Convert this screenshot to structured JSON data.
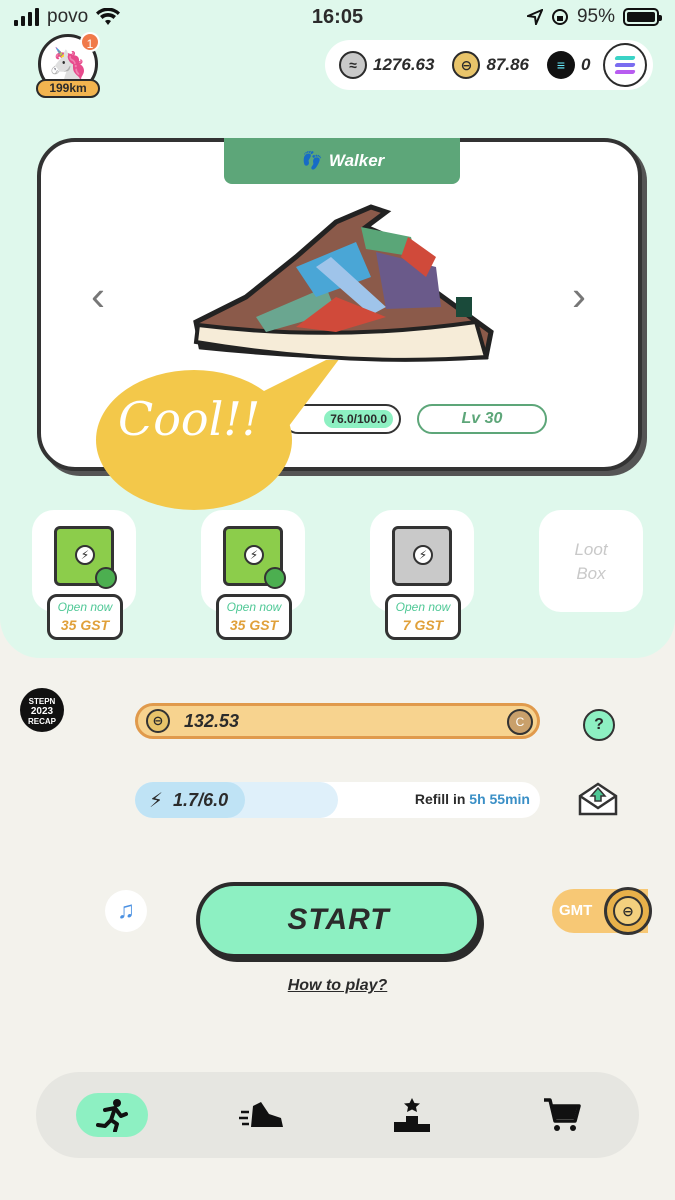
{
  "status_bar": {
    "carrier": "povo",
    "time": "16:05",
    "battery": "95%"
  },
  "profile": {
    "notification_count": "1",
    "distance": "199km"
  },
  "balances": {
    "gst": "1276.63",
    "gmt": "87.86",
    "sol": "0"
  },
  "sneaker": {
    "type": "Walker",
    "durability": "76.0/100.0",
    "level": "Lv 30",
    "speech_bubble": "Cool!!"
  },
  "mystery_boxes": [
    {
      "open_label": "Open now",
      "cost": "35 GST"
    },
    {
      "open_label": "Open now",
      "cost": "35 GST"
    },
    {
      "open_label": "Open now",
      "cost": "7 GST"
    }
  ],
  "loot_box_label": {
    "line1": "Loot",
    "line2": "Box"
  },
  "recap": {
    "line1": "STEPN",
    "line2": "2023",
    "line3": "RECAP"
  },
  "gst_earned": {
    "value": "132.53",
    "badge": "C"
  },
  "energy": {
    "value": "1.7/6.0",
    "fraction": 0.283,
    "refill_label": "Refill in",
    "refill_time": "5h 55min"
  },
  "help_label": "?",
  "start_label": "START",
  "how_to_play": "How to play?",
  "gmt_toggle": {
    "label": "GMT"
  },
  "colors": {
    "accent": "#8df0c2",
    "walker": "#5da679",
    "gst": "#f7d38f"
  }
}
